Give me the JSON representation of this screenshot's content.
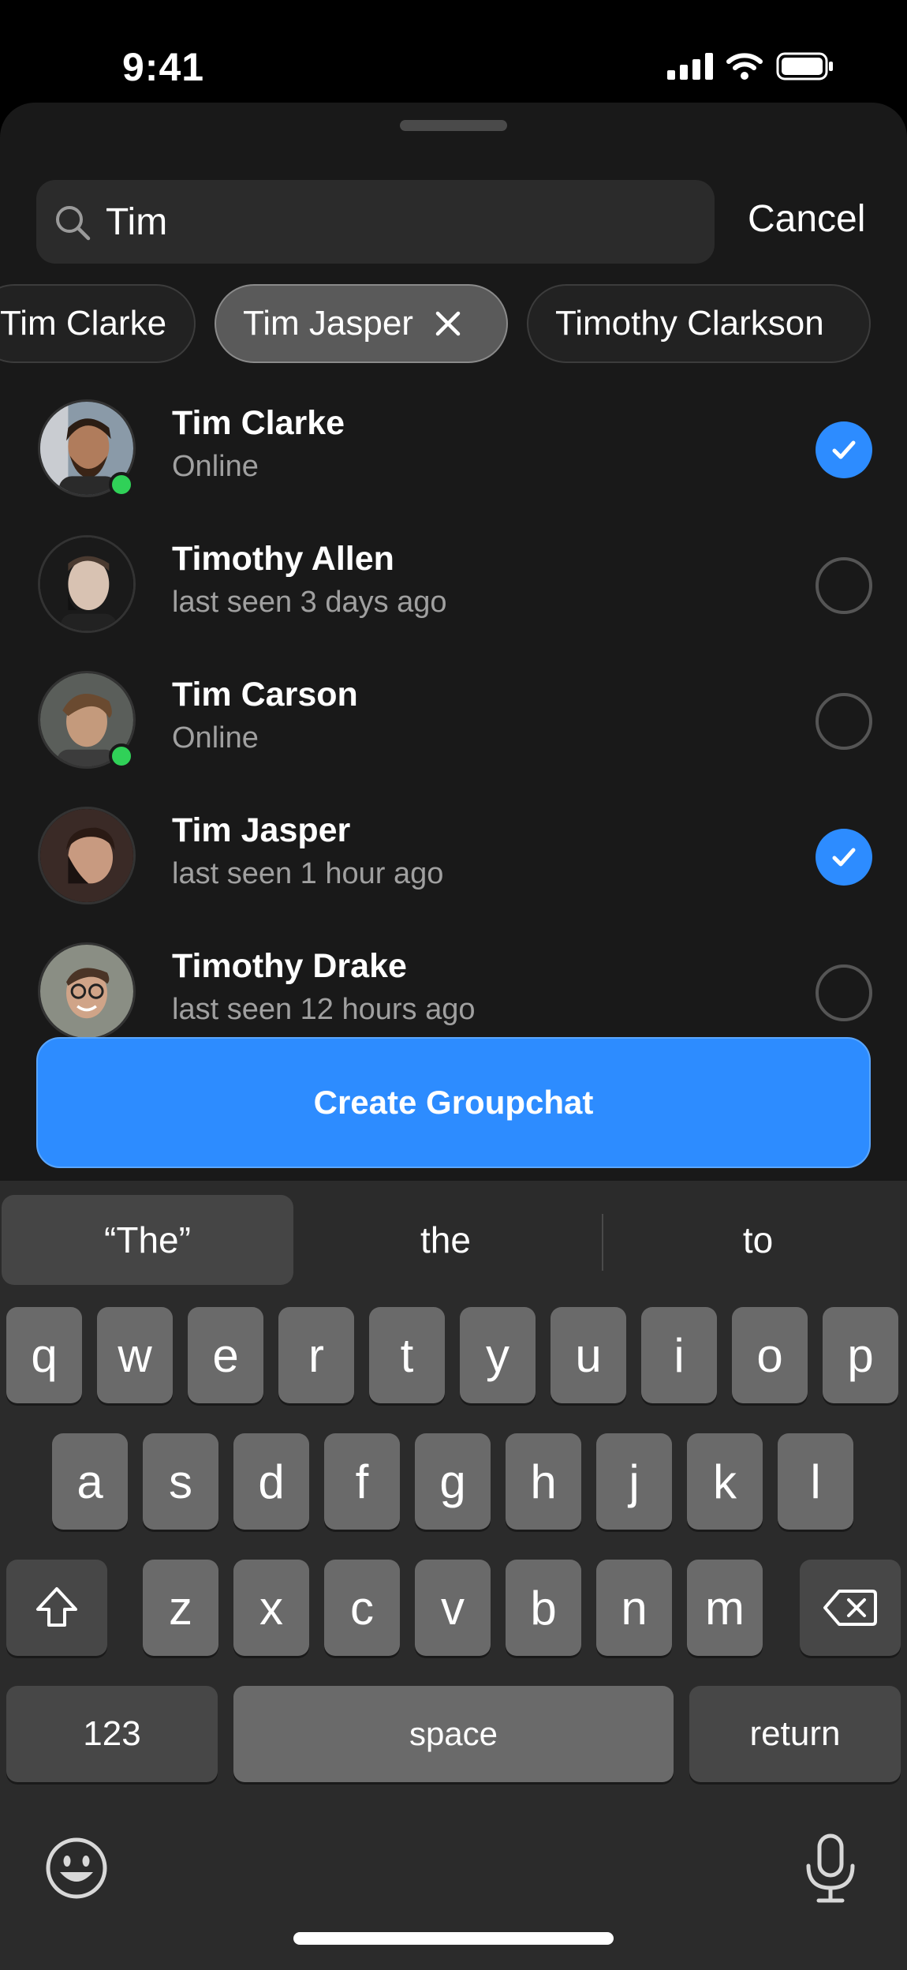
{
  "status_bar": {
    "time": "9:41"
  },
  "search": {
    "value": "Tim",
    "cancel_label": "Cancel"
  },
  "chips": [
    {
      "label": "Tim Clarke",
      "selected": false
    },
    {
      "label": "Tim Jasper",
      "selected": true
    },
    {
      "label": "Timothy Clarkson",
      "selected": false
    }
  ],
  "contacts": [
    {
      "name": "Tim Clarke",
      "status": "Online",
      "online": true,
      "checked": true
    },
    {
      "name": "Timothy Allen",
      "status": "last seen 3 days ago",
      "online": false,
      "checked": false
    },
    {
      "name": "Tim Carson",
      "status": "Online",
      "online": true,
      "checked": false
    },
    {
      "name": "Tim Jasper",
      "status": "last seen 1 hour ago",
      "online": false,
      "checked": true
    },
    {
      "name": "Timothy Drake",
      "status": "last seen 12 hours ago",
      "online": false,
      "checked": false
    }
  ],
  "create_button_label": "Create Groupchat",
  "keyboard": {
    "suggestions": [
      "“The”",
      "the",
      "to"
    ],
    "row1": [
      "q",
      "w",
      "e",
      "r",
      "t",
      "y",
      "u",
      "i",
      "o",
      "p"
    ],
    "row2": [
      "a",
      "s",
      "d",
      "f",
      "g",
      "h",
      "j",
      "k",
      "l"
    ],
    "row3": [
      "z",
      "x",
      "c",
      "v",
      "b",
      "n",
      "m"
    ],
    "numbers_label": "123",
    "space_label": "space",
    "return_label": "return"
  },
  "colors": {
    "accent": "#2d8cff",
    "online": "#30d158",
    "background": "#191919"
  }
}
